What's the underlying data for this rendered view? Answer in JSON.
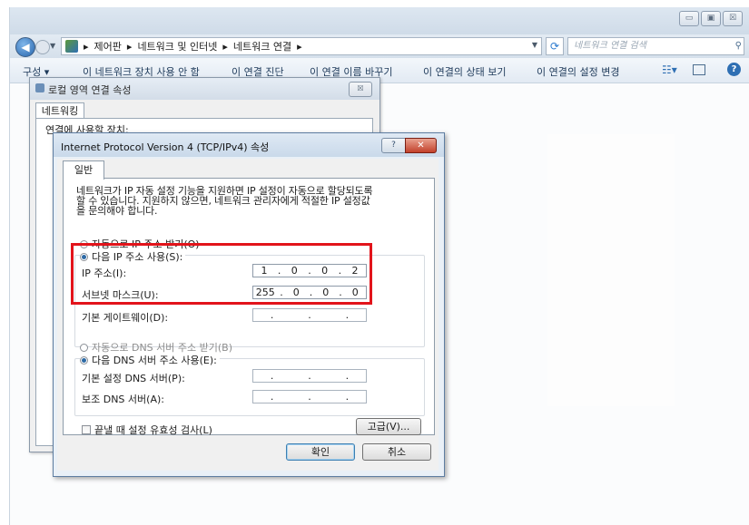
{
  "explorer": {
    "window_controls": [
      "▭",
      "▣",
      "☒"
    ],
    "breadcrumb": [
      "제어판",
      "네트워크 및 인터넷",
      "네트워크 연결"
    ],
    "breadcrumb_sep": "▸",
    "search_placeholder": "네트워크 연결 검색",
    "commands": [
      "구성 ▾",
      "이 네트워크 장치 사용 안 함",
      "이 연결 진단",
      "이 연결 이름 바꾸기",
      "이 연결의 상태 보기",
      "이 연결의 설정 변경"
    ]
  },
  "lan_dialog": {
    "title": "로컬 영역 연결 속성",
    "close": "☒",
    "tab": "네트워킹",
    "connect_using_label": "연결에 사용할 장치:"
  },
  "tcp_dialog": {
    "title": "Internet Protocol Version 4 (TCP/IPv4) 속성",
    "help": "?",
    "close": "✕",
    "tab": "일반",
    "description": [
      "네트워크가 IP 자동 설정 기능을 지원하면 IP 설정이 자동으로 할당되도록",
      "할 수 있습니다. 지원하지 않으면, 네트워크 관리자에게 적절한 IP 설정값",
      "을 문의해야 합니다."
    ],
    "ip_auto": "자동으로 IP 주소 받기(O)",
    "ip_manual": "다음 IP 주소 사용(S):",
    "ip_address_label": "IP 주소(I):",
    "ip_address": [
      "1",
      "0",
      "0",
      "2"
    ],
    "subnet_label": "서브넷 마스크(U):",
    "subnet": [
      "255",
      "0",
      "0",
      "0"
    ],
    "gateway_label": "기본 게이트웨이(D):",
    "gateway": [
      ".",
      ".",
      "."
    ],
    "dns_auto": "자동으로 DNS 서버 주소 받기(B)",
    "dns_manual": "다음 DNS 서버 주소 사용(E):",
    "dns_pref_label": "기본 설정 DNS 서버(P):",
    "dns_alt_label": "보조 DNS 서버(A):",
    "dns_pref": [
      ".",
      ".",
      "."
    ],
    "dns_alt": [
      ".",
      ".",
      "."
    ],
    "validate_label": "끝낼 때 설정 유효성 검사(L)",
    "advanced": "고급(V)...",
    "ok": "확인",
    "cancel": "취소"
  },
  "colors": {
    "highlight": "#e2141b",
    "radio_selected": "#2d6aa5"
  }
}
